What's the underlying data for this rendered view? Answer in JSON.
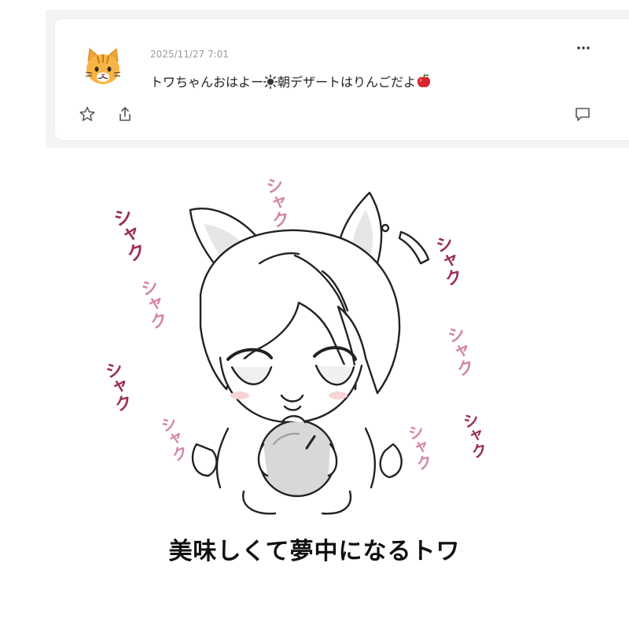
{
  "post": {
    "author_avatar": "cat-face-icon",
    "timestamp": "2025/11/27 7:01",
    "text_before": "トワちゃんおはよー",
    "text_sun_icon": "sun-icon",
    "text_middle": "朝デザートはりんごだよ",
    "text_apple_icon": "red-apple-icon",
    "menu_icon": "more-dots-icon",
    "actions": {
      "favorite_icon": "star-icon",
      "share_icon": "share-icon",
      "comment_icon": "comment-icon"
    }
  },
  "illustration": {
    "sound_effect": "シャク",
    "caption": "美味しくて夢中になるトワ",
    "colors": {
      "sfx_dark": "#9b2d5a",
      "sfx_light": "#d486a8"
    }
  }
}
